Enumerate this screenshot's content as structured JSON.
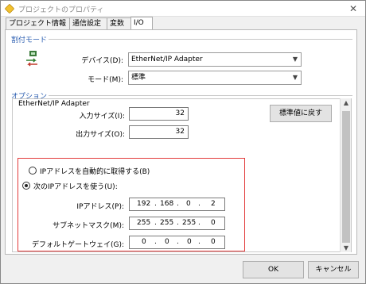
{
  "window": {
    "title": "プロジェクトのプロパティ"
  },
  "tabs": [
    {
      "label": "プロジェクト情報"
    },
    {
      "label": "通信設定"
    },
    {
      "label": "変数"
    },
    {
      "label": "I/O"
    }
  ],
  "assign_mode": {
    "group_label": "割付モード",
    "device_label": "デバイス(D):",
    "device_value": "EtherNet/IP Adapter",
    "mode_label": "モード(M):",
    "mode_value": "標準"
  },
  "options": {
    "group_label": "オプション",
    "section_title": "EtherNet/IP Adapter",
    "input_size_label": "入力サイズ(I):",
    "input_size_value": "32",
    "output_size_label": "出力サイズ(O):",
    "output_size_value": "32",
    "reset_button_label": "標準値に戻す",
    "radio_auto_label": "IPアドレスを自動的に取得する(B)",
    "radio_manual_label": "次のIPアドレスを使う(U):",
    "ip_label": "IPアドレス(P):",
    "ip_octets": [
      "192",
      "168",
      "0",
      "2"
    ],
    "subnet_label": "サブネットマスク(M):",
    "subnet_octets": [
      "255",
      "255",
      "255",
      "0"
    ],
    "gateway_label": "デフォルトゲートウェイ(G):",
    "gateway_octets": [
      "0",
      "0",
      "0",
      "0"
    ]
  },
  "footer": {
    "ok_label": "OK",
    "cancel_label": "キャンセル"
  },
  "colors": {
    "group_label": "#2a5db0",
    "highlight_box": "#e23b3b"
  }
}
